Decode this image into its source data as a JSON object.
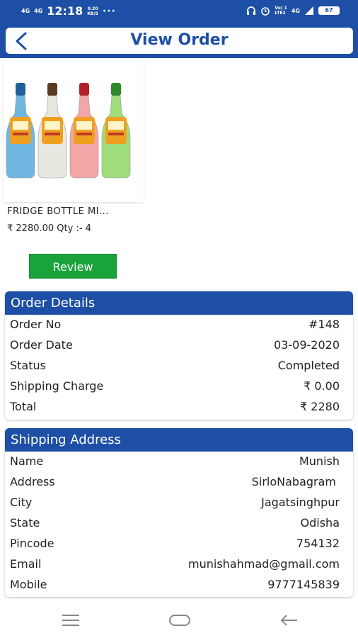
{
  "status_bar": {
    "network_left_1": "4G",
    "network_left_2": "4G",
    "time": "12:18",
    "speed_value": "0.20",
    "speed_unit": "KB/S",
    "more": "···",
    "volte_line1": "Vo) 1",
    "volte_line2": "LTE2",
    "network_right": "4G",
    "battery": "67"
  },
  "header": {
    "title": "View Order"
  },
  "product": {
    "name": "FRIDGE BOTTLE MI...",
    "price_qty": "₹ 2280.00  Qty :- 4",
    "bottle_colors": [
      "#6fb6e0",
      "#e8e8e0",
      "#f2a6a6",
      "#9fdc7c"
    ],
    "cap_colors": [
      "#1f5f9e",
      "#5a3a22",
      "#b21f2a",
      "#2f8a2a"
    ]
  },
  "review_button": {
    "label": "Review"
  },
  "order_details": {
    "title": "Order Details",
    "rows": [
      {
        "label": "Order No",
        "value": "#148"
      },
      {
        "label": "Order Date",
        "value": "03-09-2020"
      },
      {
        "label": "Status",
        "value": "Completed"
      },
      {
        "label": "Shipping Charge",
        "value": "₹ 0.00"
      },
      {
        "label": "Total",
        "value": "₹ 2280"
      }
    ]
  },
  "shipping_address": {
    "title": "Shipping Address",
    "rows": [
      {
        "label": "Name",
        "value": "Munish"
      },
      {
        "label": "Address",
        "value": "SirloNabagram"
      },
      {
        "label": "City",
        "value": "Jagatsinghpur"
      },
      {
        "label": "State",
        "value": "Odisha"
      },
      {
        "label": "Pincode",
        "value": "754132"
      },
      {
        "label": "Email",
        "value": "munishahmad@gmail.com"
      },
      {
        "label": "Mobile",
        "value": "9777145839"
      }
    ]
  },
  "nav_icons": [
    "menu-icon",
    "home-icon",
    "back-arrow-icon"
  ],
  "colors": {
    "primary": "#1e4fa6",
    "review_green": "#1aa33a"
  }
}
